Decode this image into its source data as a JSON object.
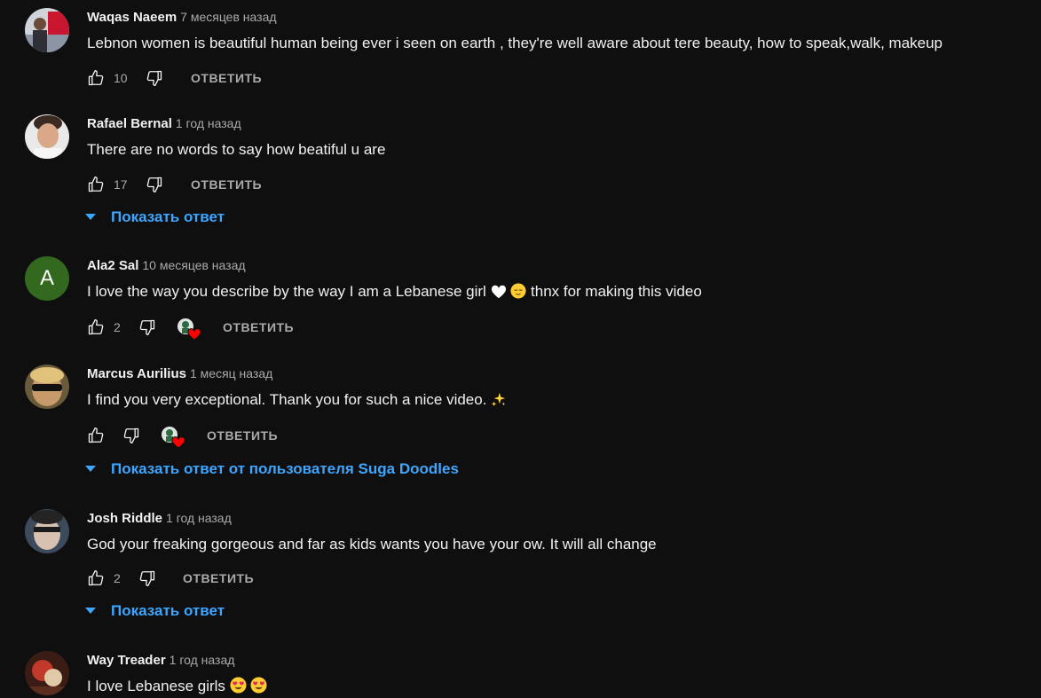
{
  "comments": [
    {
      "author": "Waqas Naeem",
      "time": "7 месяцев назад",
      "text": "Lebnon women is beautiful human being ever i seen on earth , they're well aware about tere beauty, how to speak,walk, makeup",
      "likes": "10",
      "reply_label": "ОТВЕТИТЬ"
    },
    {
      "author": "Rafael Bernal",
      "time": "1 год назад",
      "text": "There are no words to say how beatiful u are",
      "likes": "17",
      "reply_label": "ОТВЕТИТЬ",
      "replies_label": "Показать ответ"
    },
    {
      "author": "Ala2 Sal",
      "avatar_letter": "A",
      "avatar_color": "#33691e",
      "time": "10 месяцев назад",
      "text_before": "I love the way you describe by the way I am a Lebanese girl",
      "text_after": "thnx for making this video",
      "likes": "2",
      "reply_label": "ОТВЕТИТЬ"
    },
    {
      "author": "Marcus Aurilius",
      "time": "1 месяц назад",
      "text": "I find you very exceptional. Thank you for such a nice video.",
      "likes": "",
      "reply_label": "ОТВЕТИТЬ",
      "replies_label": "Показать ответ от пользователя Suga Doodles"
    },
    {
      "author": "Josh Riddle",
      "time": "1 год назад",
      "text": "God your freaking gorgeous and far as kids wants you have your ow. It will all change",
      "likes": "2",
      "reply_label": "ОТВЕТИТЬ",
      "replies_label": "Показать ответ"
    },
    {
      "author": "Way Treader",
      "time": "1 год назад",
      "text": "I love Lebanese girls"
    }
  ],
  "colors": {
    "background": "#0f0f0f",
    "link": "#3ea6ff",
    "secondary_text": "#aaaaaa",
    "heart": "#ff0000"
  },
  "icons": {
    "like": "thumb-up-icon",
    "dislike": "thumb-down-icon",
    "creator_heart": "creator-heart-icon",
    "expand": "caret-down-icon"
  }
}
